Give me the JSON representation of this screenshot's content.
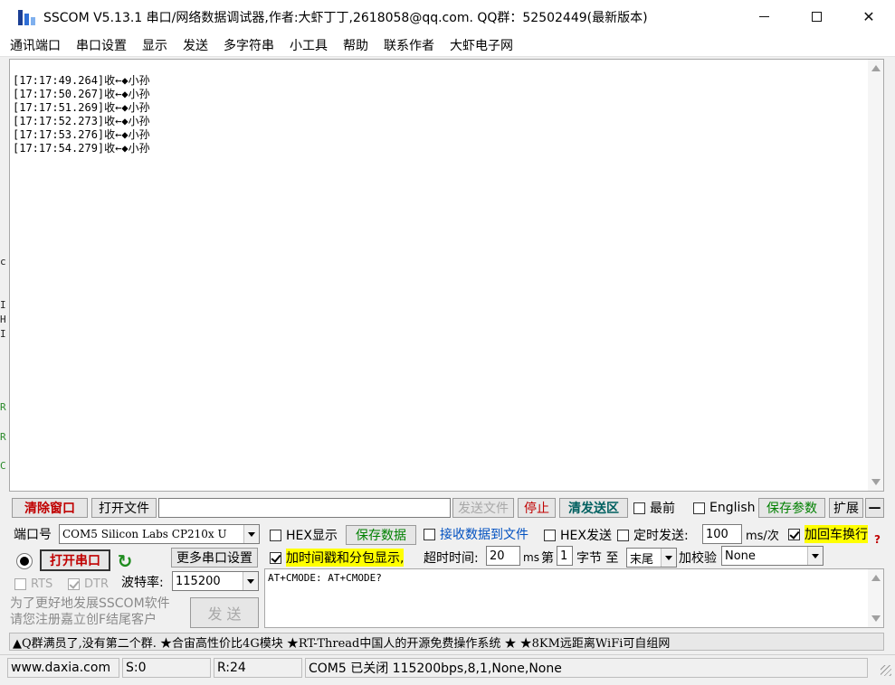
{
  "window": {
    "title": "SSCOM V5.13.1 串口/网络数据调试器,作者:大虾丁丁,2618058@qq.com. QQ群：52502449(最新版本)"
  },
  "menu": [
    "通讯端口",
    "串口设置",
    "显示",
    "发送",
    "多字符串",
    "小工具",
    "帮助",
    "联系作者",
    "大虾电子网"
  ],
  "receive": {
    "lines": [
      "[17:17:49.264]收←◆小孙",
      "[17:17:50.267]收←◆小孙",
      "[17:17:51.269]收←◆小孙",
      "[17:17:52.273]收←◆小孙",
      "[17:17:53.276]收←◆小孙",
      "[17:17:54.279]收←◆小孙"
    ]
  },
  "edge_fragments": [
    "c",
    "I",
    "H",
    "I",
    "R",
    "R",
    "C"
  ],
  "toolbar1": {
    "clear_label": "清除窗口",
    "open_file_label": "打开文件",
    "file_path": "",
    "send_file_label": "发送文件",
    "stop_label": "停止",
    "clear_send_label": "清发送区",
    "front_label": "最前",
    "english_label": "English",
    "save_params_label": "保存参数",
    "expand_label": "扩展",
    "collapse_label": "—"
  },
  "row1": {
    "port_label": "端口号",
    "port_value": "COM5 Silicon Labs CP210x U",
    "hex_display_label": "HEX显示",
    "save_data_label": "保存数据",
    "recv_to_file_label": "接收数据到文件",
    "hex_send_label": "HEX发送",
    "timed_send_label": "定时发送:",
    "interval_value": "100",
    "interval_unit": "ms/次",
    "crlf_label": "加回车换行",
    "help_mark": "?"
  },
  "row2": {
    "open_port_label": "打开串口",
    "more_settings_label": "更多串口设置",
    "timestamp_label": "加时间戳和分包显示,",
    "timeout_label": "超时时间:",
    "timeout_value": "20",
    "timeout_unit": "ms",
    "nth_label": "第",
    "nth_value": "1",
    "byte_label": "字节 至",
    "end_value": "末尾",
    "checksum_label": "加校验",
    "checksum_value": "None"
  },
  "row3": {
    "rts_label": "RTS",
    "dtr_label": "DTR",
    "baud_label": "波特率:",
    "baud_value": "115200"
  },
  "send": {
    "text": "AT+CMODE: AT+CMODE?",
    "send_label": "发 送",
    "promo_line1": "为了更好地发展SSCOM软件",
    "promo_line2": "请您注册嘉立创F结尾客户"
  },
  "ticker": "▲Q群满员了,没有第二个群. ★合宙高性价比4G模块 ★RT-Thread中国人的开源免费操作系统 ★ ★8KM远距离WiFi可自组网",
  "status": {
    "website": "www.daxia.com",
    "sent": "S:0",
    "received": "R:24",
    "port_state": "COM5 已关闭  115200bps,8,1,None,None"
  },
  "colors": {
    "accent_red": "#c00000",
    "accent_green": "#008000",
    "accent_blue": "#0050c0",
    "highlight": "#ffff00"
  }
}
